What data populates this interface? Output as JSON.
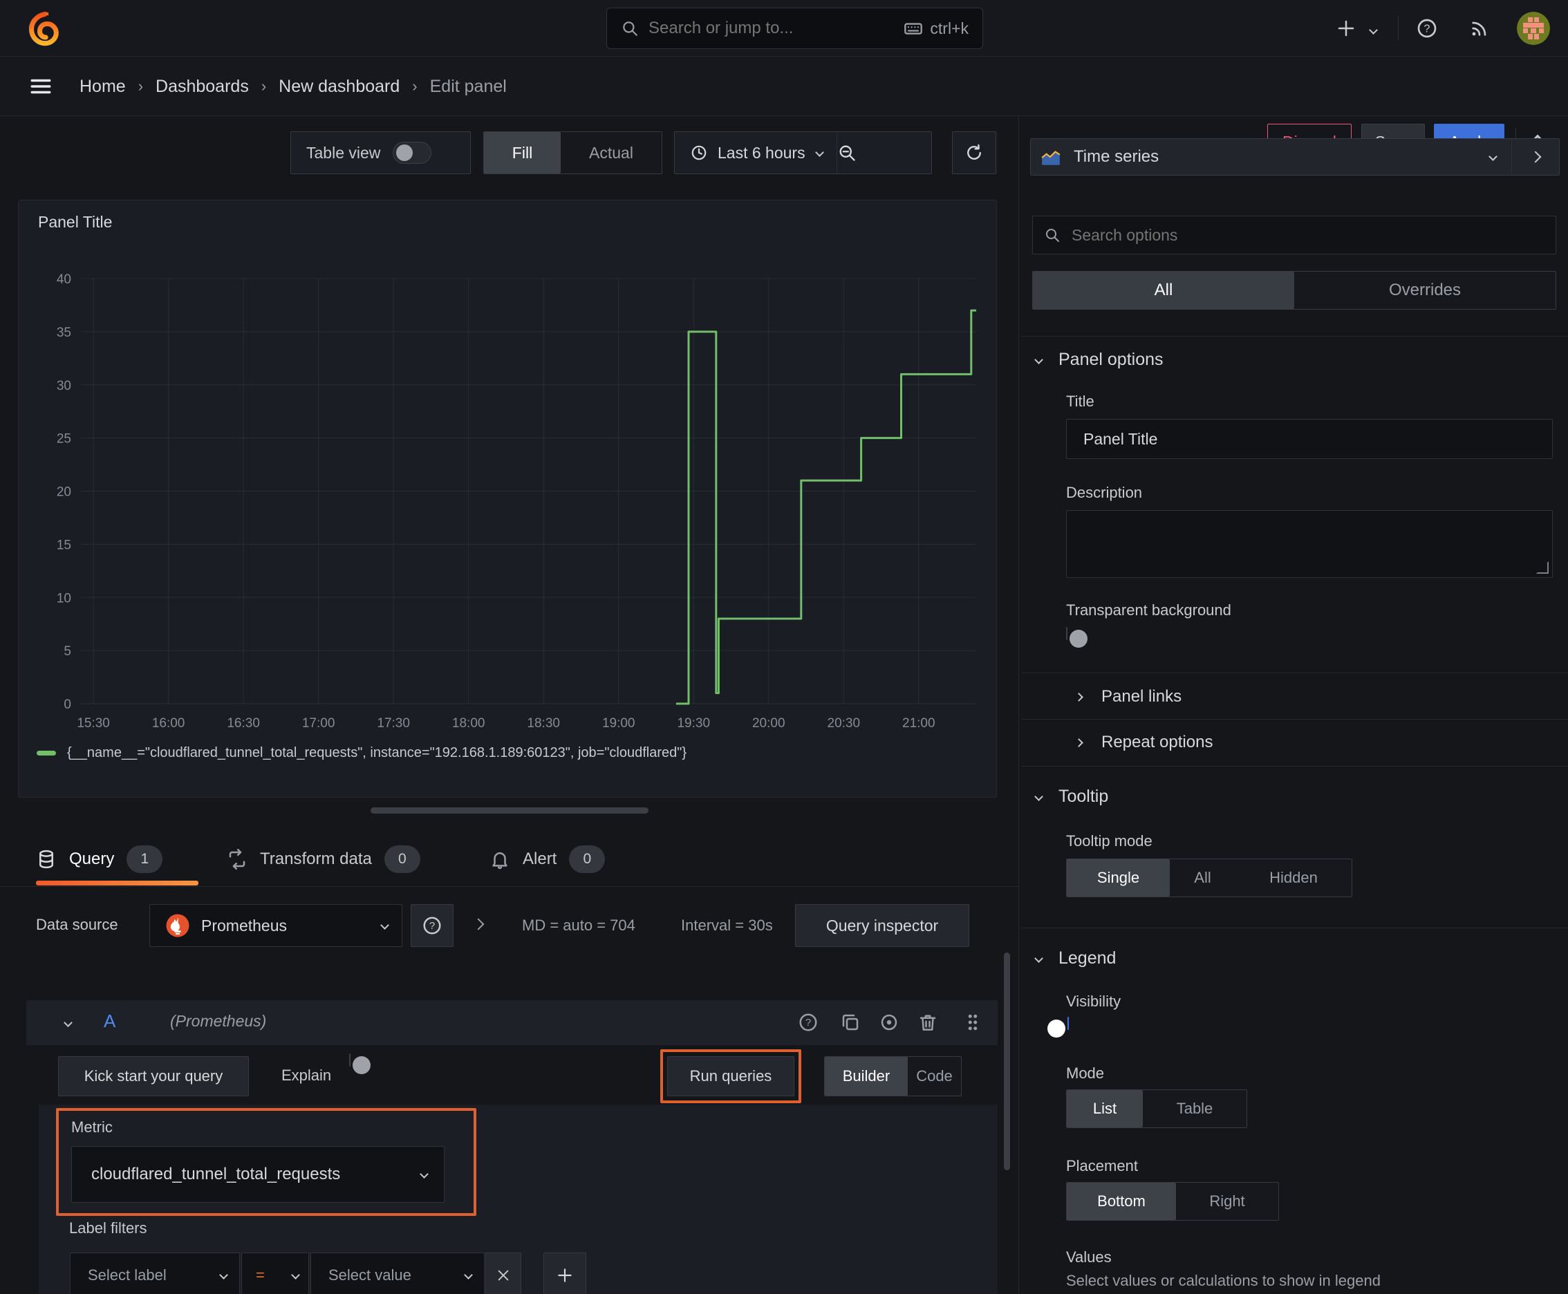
{
  "topnav": {
    "search_placeholder": "Search or jump to...",
    "search_shortcut": "ctrl+k"
  },
  "breadcrumb": {
    "items": [
      "Home",
      "Dashboards",
      "New dashboard",
      "Edit panel"
    ],
    "discard_label": "Discard",
    "save_label": "Save",
    "apply_label": "Apply"
  },
  "toolbar": {
    "table_view_label": "Table view",
    "fill_label": "Fill",
    "actual_label": "Actual",
    "time_range_label": "Last 6 hours"
  },
  "viz_picker": {
    "label": "Time series"
  },
  "panel": {
    "title": "Panel Title",
    "legend_text": "{__name__=\"cloudflared_tunnel_total_requests\", instance=\"192.168.1.189:60123\", job=\"cloudflared\"}"
  },
  "chart_data": {
    "type": "line",
    "title": "Panel Title",
    "step": true,
    "x_ticks": [
      "15:30",
      "16:00",
      "16:30",
      "17:00",
      "17:30",
      "18:00",
      "18:30",
      "19:00",
      "19:30",
      "20:00",
      "20:30",
      "21:00"
    ],
    "y_ticks": [
      0,
      5,
      10,
      15,
      20,
      25,
      30,
      35,
      40
    ],
    "ylim": [
      0,
      40
    ],
    "x_range": [
      "15:25",
      "21:23"
    ],
    "grid": true,
    "legend_position": "bottom",
    "series": [
      {
        "name": "{__name__=\"cloudflared_tunnel_total_requests\", instance=\"192.168.1.189:60123\", job=\"cloudflared\"}",
        "color": "#73bf69",
        "points": [
          [
            "19:23",
            0
          ],
          [
            "19:28",
            35
          ],
          [
            "19:39",
            1
          ],
          [
            "19:40",
            8
          ],
          [
            "20:13",
            21
          ],
          [
            "20:37",
            25
          ],
          [
            "20:53",
            31
          ],
          [
            "21:21",
            37
          ]
        ],
        "end_time": "21:23"
      }
    ]
  },
  "tabs": {
    "query": {
      "label": "Query",
      "count": "1"
    },
    "transform": {
      "label": "Transform data",
      "count": "0"
    },
    "alert": {
      "label": "Alert",
      "count": "0"
    }
  },
  "query_editor": {
    "datasource_label": "Data source",
    "datasource_value": "Prometheus",
    "stats_md": "MD = auto = 704",
    "stats_interval": "Interval = 30s",
    "query_inspector_label": "Query inspector",
    "row_ref": "A",
    "row_ds": "(Prometheus)",
    "kickstart_label": "Kick start your query",
    "explain_label": "Explain",
    "run_queries_label": "Run queries",
    "builder_label": "Builder",
    "code_label": "Code",
    "metric_label": "Metric",
    "metric_value": "cloudflared_tunnel_total_requests",
    "label_filters_label": "Label filters",
    "select_label_placeholder": "Select label",
    "operator_value": "=",
    "select_value_placeholder": "Select value"
  },
  "options_pane": {
    "search_placeholder": "Search options",
    "tab_all": "All",
    "tab_overrides": "Overrides",
    "panel_options": {
      "title": "Panel options",
      "title_label": "Title",
      "title_value": "Panel Title",
      "description_label": "Description",
      "transparent_label": "Transparent background"
    },
    "panel_links_label": "Panel links",
    "repeat_options_label": "Repeat options",
    "tooltip": {
      "title": "Tooltip",
      "mode_label": "Tooltip mode",
      "options": [
        "Single",
        "All",
        "Hidden"
      ],
      "selected": "Single"
    },
    "legend": {
      "title": "Legend",
      "visibility_label": "Visibility",
      "mode_label": "Mode",
      "mode_options": [
        "List",
        "Table"
      ],
      "mode_selected": "List",
      "placement_label": "Placement",
      "placement_options": [
        "Bottom",
        "Right"
      ],
      "placement_selected": "Bottom",
      "values_label": "Values",
      "values_hint": "Select values or calculations to show in legend"
    }
  },
  "colors": {
    "accent_blue": "#3d71d9",
    "destructive_pink": "#f2527c",
    "annotation_orange": "#e0612f",
    "series_green": "#73bf69",
    "tab_underline_orange": "#f05a28"
  }
}
